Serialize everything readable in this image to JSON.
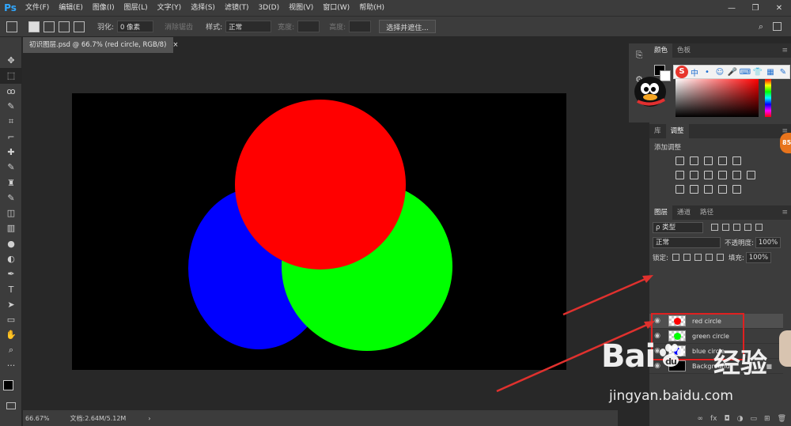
{
  "app": {
    "logo": "Ps"
  },
  "menu": [
    "文件(F)",
    "编辑(E)",
    "图像(I)",
    "图层(L)",
    "文字(Y)",
    "选择(S)",
    "滤镜(T)",
    "3D(D)",
    "视图(V)",
    "窗口(W)",
    "帮助(H)"
  ],
  "window_controls": {
    "minimize": "—",
    "restore": "❐",
    "close": "✕"
  },
  "options_bar": {
    "feather_label": "羽化:",
    "feather_value": "0 像素",
    "antialias_label": "消除锯齿",
    "style_label": "样式:",
    "style_value": "正常",
    "width_label": "宽度:",
    "height_label": "高度:",
    "select_mask_button": "选择并遮住..."
  },
  "document": {
    "tab_title": "初识图层.psd @ 66.7% (red circle, RGB/8)",
    "tab_close": "×"
  },
  "status_bar": {
    "zoom": "66.67%",
    "doc_info": "文档:2.64M/5.12M",
    "arrow": "›"
  },
  "color_panel": {
    "tabs": [
      "颜色",
      "色板"
    ],
    "ime_logo": "S",
    "ime_mode": "中"
  },
  "adjust_panel": {
    "tabs": [
      "库",
      "调整"
    ],
    "title": "添加调整"
  },
  "layers_panel": {
    "tabs": [
      "图层",
      "通道",
      "路径"
    ],
    "filter_label": "ρ 类型",
    "blend_mode": "正常",
    "opacity_label": "不透明度:",
    "opacity_value": "100%",
    "lock_label": "锁定:",
    "fill_label": "填充:",
    "fill_value": "100%",
    "layers": [
      {
        "name": "red circle",
        "color": "#ff0000",
        "selected": true
      },
      {
        "name": "green circle",
        "color": "#00ff00",
        "selected": false
      },
      {
        "name": "blue circle",
        "color": "#0000ff",
        "selected": false
      },
      {
        "name": "Background",
        "color": "#000000",
        "selected": false,
        "locked": true
      }
    ],
    "footer_icons": [
      "link-icon",
      "fx-icon",
      "mask-icon",
      "adjustment-icon",
      "folder-icon",
      "new-layer-icon",
      "trash-icon"
    ]
  },
  "canvas": {
    "background": "#000000",
    "circles": [
      {
        "name": "blue circle",
        "color": "#0000ff"
      },
      {
        "name": "green circle",
        "color": "#00ff00"
      },
      {
        "name": "red circle",
        "color": "#ff0000"
      }
    ]
  },
  "annotations": {
    "arrow_color": "#e0312e",
    "highlight_color": "#e02020"
  },
  "side_badge": "85",
  "watermark": {
    "brand_pre": "Bai",
    "brand_post": "",
    "brand_cn": "经验",
    "url": "jingyan.baidu.com"
  },
  "icons": {
    "move": "✥",
    "marquee": "⬚",
    "lasso": "ꝏ",
    "quick-select": "✎",
    "crop": "⌗",
    "eyedropper": "⌐",
    "heal": "✚",
    "brush": "✎",
    "stamp": "♜",
    "history-brush": "✎",
    "eraser": "◫",
    "gradient": "▥",
    "blur": "●",
    "dodge": "◐",
    "pen": "✒",
    "type": "T",
    "path-select": "➤",
    "shape": "▭",
    "hand": "✋",
    "zoom": "⌕",
    "more": "···",
    "eye": "👁",
    "lock": "🔒",
    "search": "⌕"
  }
}
